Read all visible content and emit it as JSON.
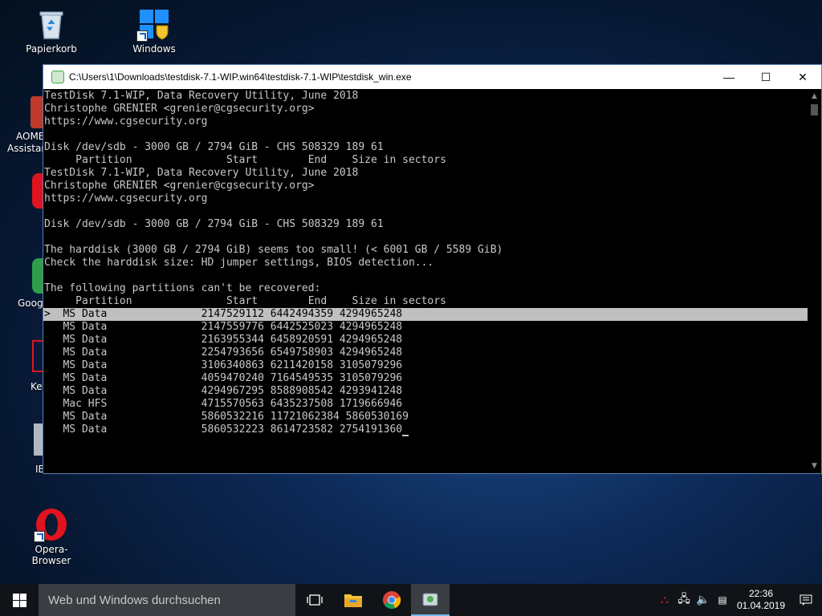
{
  "desktop": {
    "icons": [
      {
        "label": "Papierkorb",
        "icon": "recycle-bin-icon"
      },
      {
        "label": "Windows",
        "icon": "windows-update-icon"
      },
      {
        "label": "Opera-Browser",
        "icon": "opera-icon"
      }
    ],
    "partial_labels": [
      "AOME",
      "Assistan",
      "Googl",
      "Key",
      "IE"
    ]
  },
  "window": {
    "title": "C:\\Users\\1\\Downloads\\testdisk-7.1-WIP.win64\\testdisk-7.1-WIP\\testdisk_win.exe",
    "minimize": "—",
    "maximize": "☐",
    "close": "✕"
  },
  "terminal": {
    "lines": [
      "TestDisk 7.1-WIP, Data Recovery Utility, June 2018",
      "Christophe GRENIER <grenier@cgsecurity.org>",
      "https://www.cgsecurity.org",
      "",
      "Disk /dev/sdb - 3000 GB / 2794 GiB - CHS 508329 189 61",
      "     Partition               Start        End    Size in sectors",
      "TestDisk 7.1-WIP, Data Recovery Utility, June 2018",
      "Christophe GRENIER <grenier@cgsecurity.org>",
      "https://www.cgsecurity.org",
      "",
      "Disk /dev/sdb - 3000 GB / 2794 GiB - CHS 508329 189 61",
      "",
      "The harddisk (3000 GB / 2794 GiB) seems too small! (< 6001 GB / 5589 GiB)",
      "Check the harddisk size: HD jumper settings, BIOS detection...",
      "",
      "The following partitions can't be recovered:",
      "     Partition               Start        End    Size in sectors"
    ],
    "partitions": [
      {
        "text": ">  MS Data               2147529112 6442494359 4294965248",
        "selected": true
      },
      {
        "text": "   MS Data               2147559776 6442525023 4294965248",
        "selected": false
      },
      {
        "text": "   MS Data               2163955344 6458920591 4294965248",
        "selected": false
      },
      {
        "text": "   MS Data               2254793656 6549758903 4294965248",
        "selected": false
      },
      {
        "text": "   MS Data               3106340863 6211420158 3105079296",
        "selected": false
      },
      {
        "text": "   MS Data               4059470240 7164549535 3105079296",
        "selected": false
      },
      {
        "text": "   MS Data               4294967295 8588908542 4293941248",
        "selected": false
      },
      {
        "text": "   Mac HFS               4715570563 6435237508 1719666946",
        "selected": false
      },
      {
        "text": "   MS Data               5860532216 11721062384 5860530169",
        "selected": false
      },
      {
        "text": "   MS Data               5860532223 8614723582 2754191360",
        "selected": false
      }
    ]
  },
  "taskbar": {
    "search_placeholder": "Web und Windows durchsuchen",
    "clock_time": "22:36",
    "clock_date": "01.04.2019"
  },
  "colors": {
    "terminal_bg": "#000000",
    "terminal_fg": "#c8c8c8",
    "selection_bg": "#c0c0c0",
    "taskbar_bg": "#101418"
  }
}
